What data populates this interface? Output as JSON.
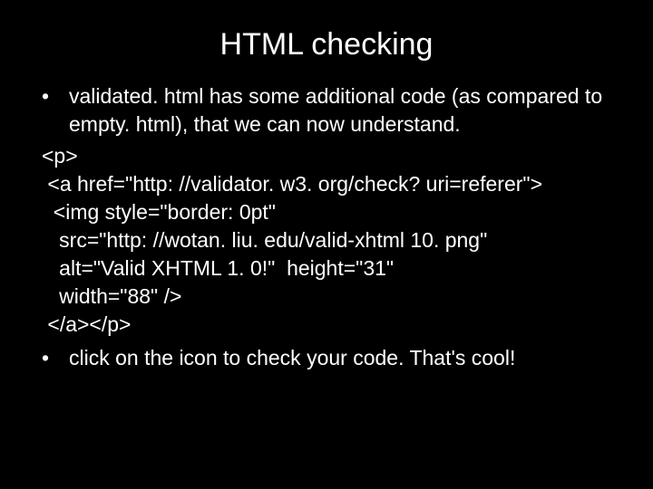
{
  "slide": {
    "title": "HTML checking",
    "bullet1": "validated. html has some additional code (as compared to empty. html), that we can now understand.",
    "code": {
      "line1": "<p>",
      "line2": " <a href=\"http: //validator. w3. org/check? uri=referer\">",
      "line3": "  <img style=\"border: 0pt\"",
      "line4": "   src=\"http: //wotan. liu. edu/valid-xhtml 10. png\"",
      "line5": "   alt=\"Valid XHTML 1. 0!\"  height=\"31\"",
      "line6": "   width=\"88\" />",
      "line7": " </a></p>"
    },
    "bullet2": "click on the icon to check your code. That's cool!"
  }
}
